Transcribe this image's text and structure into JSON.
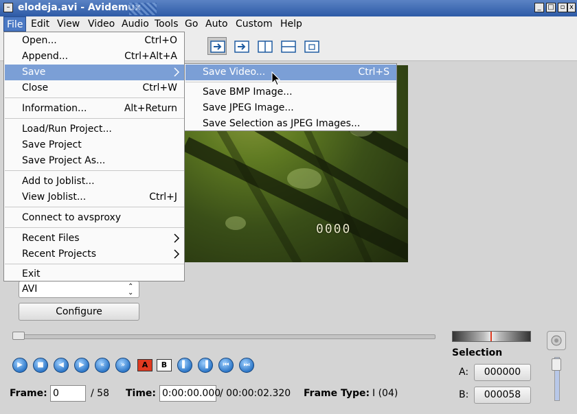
{
  "window": {
    "title": "elodeja.avi - Avidemux"
  },
  "menubar": [
    "File",
    "Edit",
    "View",
    "Video",
    "Audio",
    "Tools",
    "Go",
    "Auto",
    "Custom",
    "Help"
  ],
  "file_menu": {
    "items": [
      {
        "label": "Open...",
        "shortcut": "Ctrl+O"
      },
      {
        "label": "Append...",
        "shortcut": "Ctrl+Alt+A"
      },
      {
        "label": "Save",
        "shortcut": ""
      },
      {
        "label": "Close",
        "shortcut": "Ctrl+W"
      },
      {
        "label": "Information...",
        "shortcut": "Alt+Return"
      },
      {
        "label": "Load/Run Project...",
        "shortcut": ""
      },
      {
        "label": "Save Project",
        "shortcut": ""
      },
      {
        "label": "Save Project As...",
        "shortcut": ""
      },
      {
        "label": "Add to Joblist...",
        "shortcut": ""
      },
      {
        "label": "View Joblist...",
        "shortcut": "Ctrl+J"
      },
      {
        "label": "Connect to avsproxy",
        "shortcut": ""
      },
      {
        "label": "Recent Files",
        "shortcut": ""
      },
      {
        "label": "Recent Projects",
        "shortcut": ""
      },
      {
        "label": "Exit",
        "shortcut": ""
      }
    ]
  },
  "save_submenu": {
    "items": [
      {
        "label": "Save Video...",
        "shortcut": "Ctrl+S"
      },
      {
        "label": "Save BMP Image...",
        "shortcut": ""
      },
      {
        "label": "Save JPEG Image...",
        "shortcut": ""
      },
      {
        "label": "Save Selection as JPEG Images...",
        "shortcut": ""
      }
    ]
  },
  "video": {
    "overlay_code": "0000"
  },
  "output": {
    "container": "AVI",
    "configure_label": "Configure"
  },
  "marker_labels": {
    "a": "A",
    "b": "B"
  },
  "status": {
    "frame_label": "Frame:",
    "frame_value": "0",
    "frame_total": "/ 58",
    "time_label": "Time:",
    "time_value": "0:00:00.000",
    "time_total": "/ 00:00:02.320",
    "frame_type_label": "Frame Type:",
    "frame_type_value": "I (04)"
  },
  "selection": {
    "title": "Selection",
    "a_label": "A:",
    "a_value": "000000",
    "b_label": "B:",
    "b_value": "000058"
  },
  "colors": {
    "accent": "#4b79c4",
    "highlight": "#7b9fd6",
    "marker": "#e03a20"
  }
}
